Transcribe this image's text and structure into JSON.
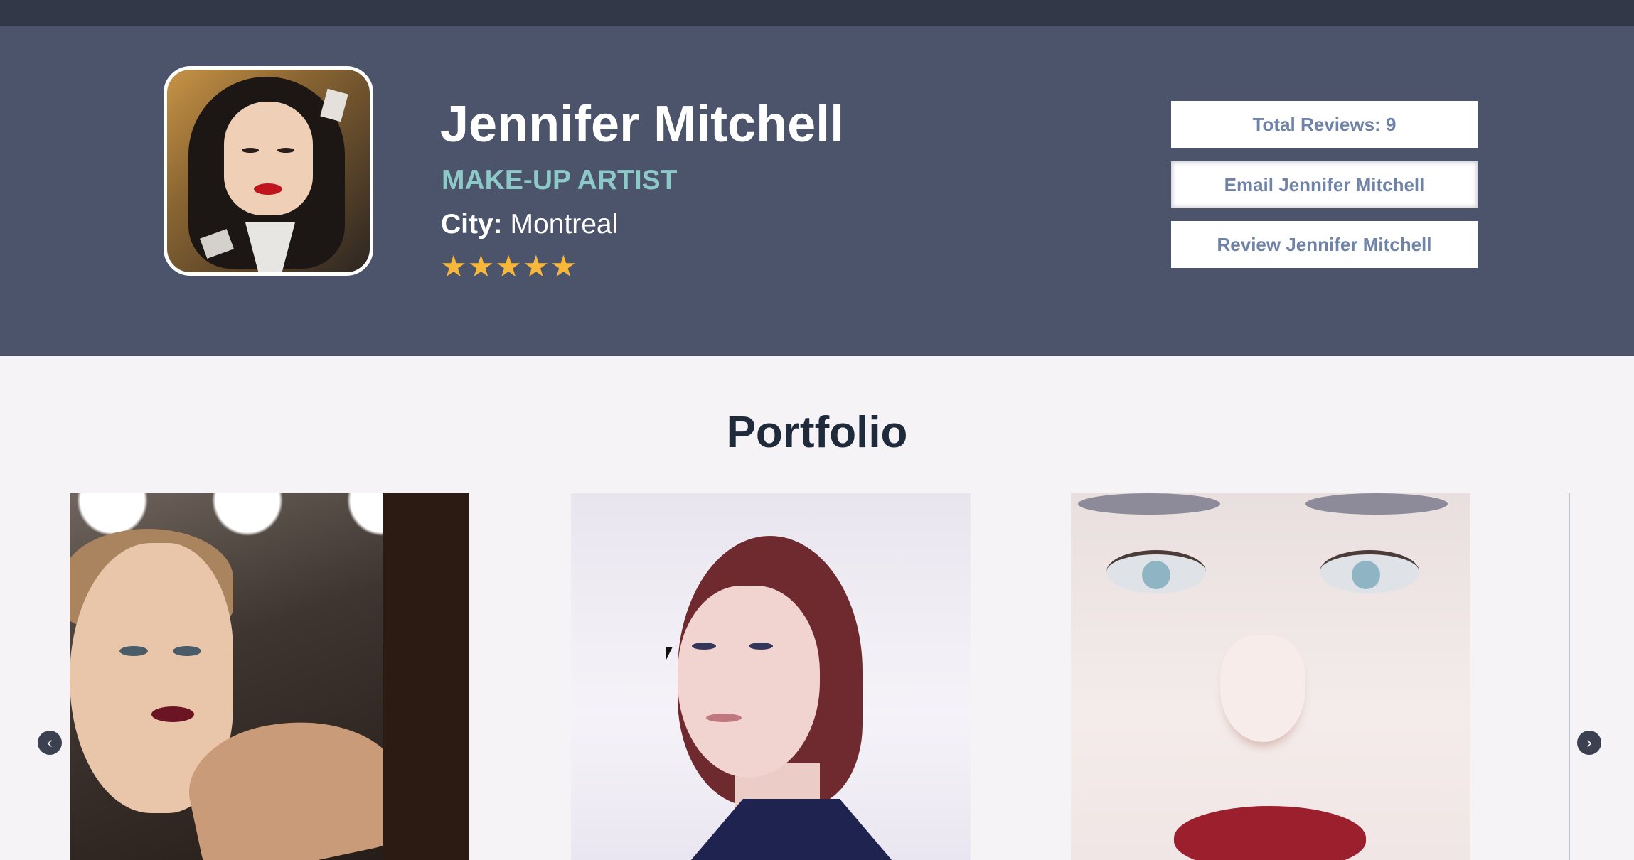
{
  "profile": {
    "name": "Jennifer Mitchell",
    "role": "MAKE-UP ARTIST",
    "city_label": "City:",
    "city_value": "Montreal",
    "stars": "★★★★★",
    "rating": 5
  },
  "actions": {
    "total_reviews": "Total Reviews: 9",
    "email": "Email Jennifer Mitchell",
    "review": "Review Jennifer Mitchell"
  },
  "portfolio": {
    "title": "Portfolio",
    "prev_arrow": "‹",
    "next_arrow": "›"
  },
  "colors": {
    "topbar": "#323848",
    "header": "#4b546b",
    "role_accent": "#8ec9ca",
    "star": "#f6b73c",
    "button_text": "#6f82a8",
    "page_bg": "#f5f3f6"
  },
  "icons": {
    "prev": "chevron-left-icon",
    "next": "chevron-right-icon",
    "star": "star-icon"
  }
}
